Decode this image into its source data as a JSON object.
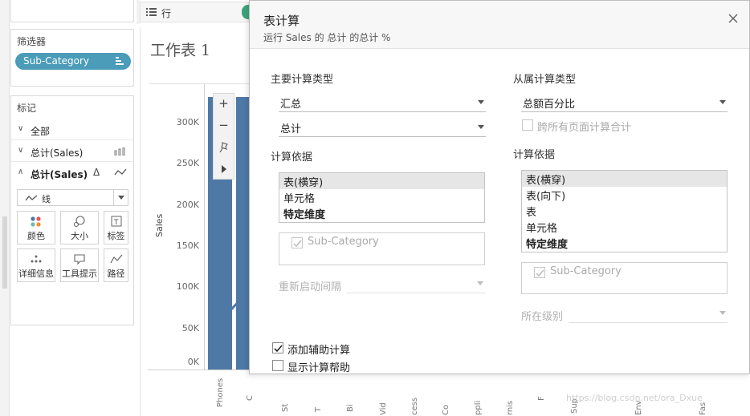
{
  "filters": {
    "title": "筛选器",
    "pill": "Sub-Category"
  },
  "marks": {
    "title": "标记",
    "rows": [
      {
        "label": "全部"
      },
      {
        "label": "总计(Sales)"
      },
      {
        "label": "总计(Sales)"
      }
    ],
    "mark_type": "线",
    "buttons": [
      {
        "label": "颜色",
        "icon": "color-icon"
      },
      {
        "label": "大小",
        "icon": "size-icon"
      },
      {
        "label": "标签",
        "icon": "label-icon"
      },
      {
        "label": "详细信息",
        "icon": "detail-icon"
      },
      {
        "label": "工具提示",
        "icon": "tooltip-icon"
      },
      {
        "label": "路径",
        "icon": "path-icon"
      }
    ]
  },
  "toolbar": {
    "rows_label": "行"
  },
  "worksheet": {
    "title": "工作表 1",
    "y_axis_title": "Sales",
    "y_ticks": [
      "300K",
      "250K",
      "200K",
      "150K",
      "100K",
      "50K",
      "0K"
    ],
    "x_labels": [
      "Phones",
      "C",
      "St",
      "T",
      "Bi",
      "Vid",
      "cess",
      "Co",
      "ppli",
      "rnis",
      "F",
      "Sup",
      "Env",
      "Fas"
    ]
  },
  "dialog": {
    "title": "表计算",
    "subtitle": "运行 Sales 的 总计 的总计 %",
    "primary": {
      "heading": "主要计算类型",
      "type_value": "汇总",
      "agg_value": "总计",
      "compute_heading": "计算依据",
      "compute_options": [
        "表(横穿)",
        "单元格",
        "特定维度"
      ],
      "selected_option": "表(横穿)",
      "dimension": "Sub-Category",
      "restart_label": "重新启动间隔"
    },
    "secondary": {
      "heading": "从属计算类型",
      "type_value": "总额百分比",
      "across_pages": "跨所有页面计算合计",
      "compute_heading": "计算依据",
      "compute_options": [
        "表(横穿)",
        "表(向下)",
        "表",
        "单元格",
        "特定维度"
      ],
      "selected_option": "表(横穿)",
      "dimension": "Sub-Category",
      "level_label": "所在级别"
    },
    "add_secondary": {
      "label": "添加辅助计算",
      "checked": true
    },
    "show_help": {
      "label": "显示计算帮助",
      "checked": false
    }
  },
  "watermark": "https://blog.csdn.net/ora_Dxue",
  "colors": {
    "bar": "#4e79a7",
    "pill": "#4a9cb8",
    "accent_green": "#3aa57b"
  }
}
